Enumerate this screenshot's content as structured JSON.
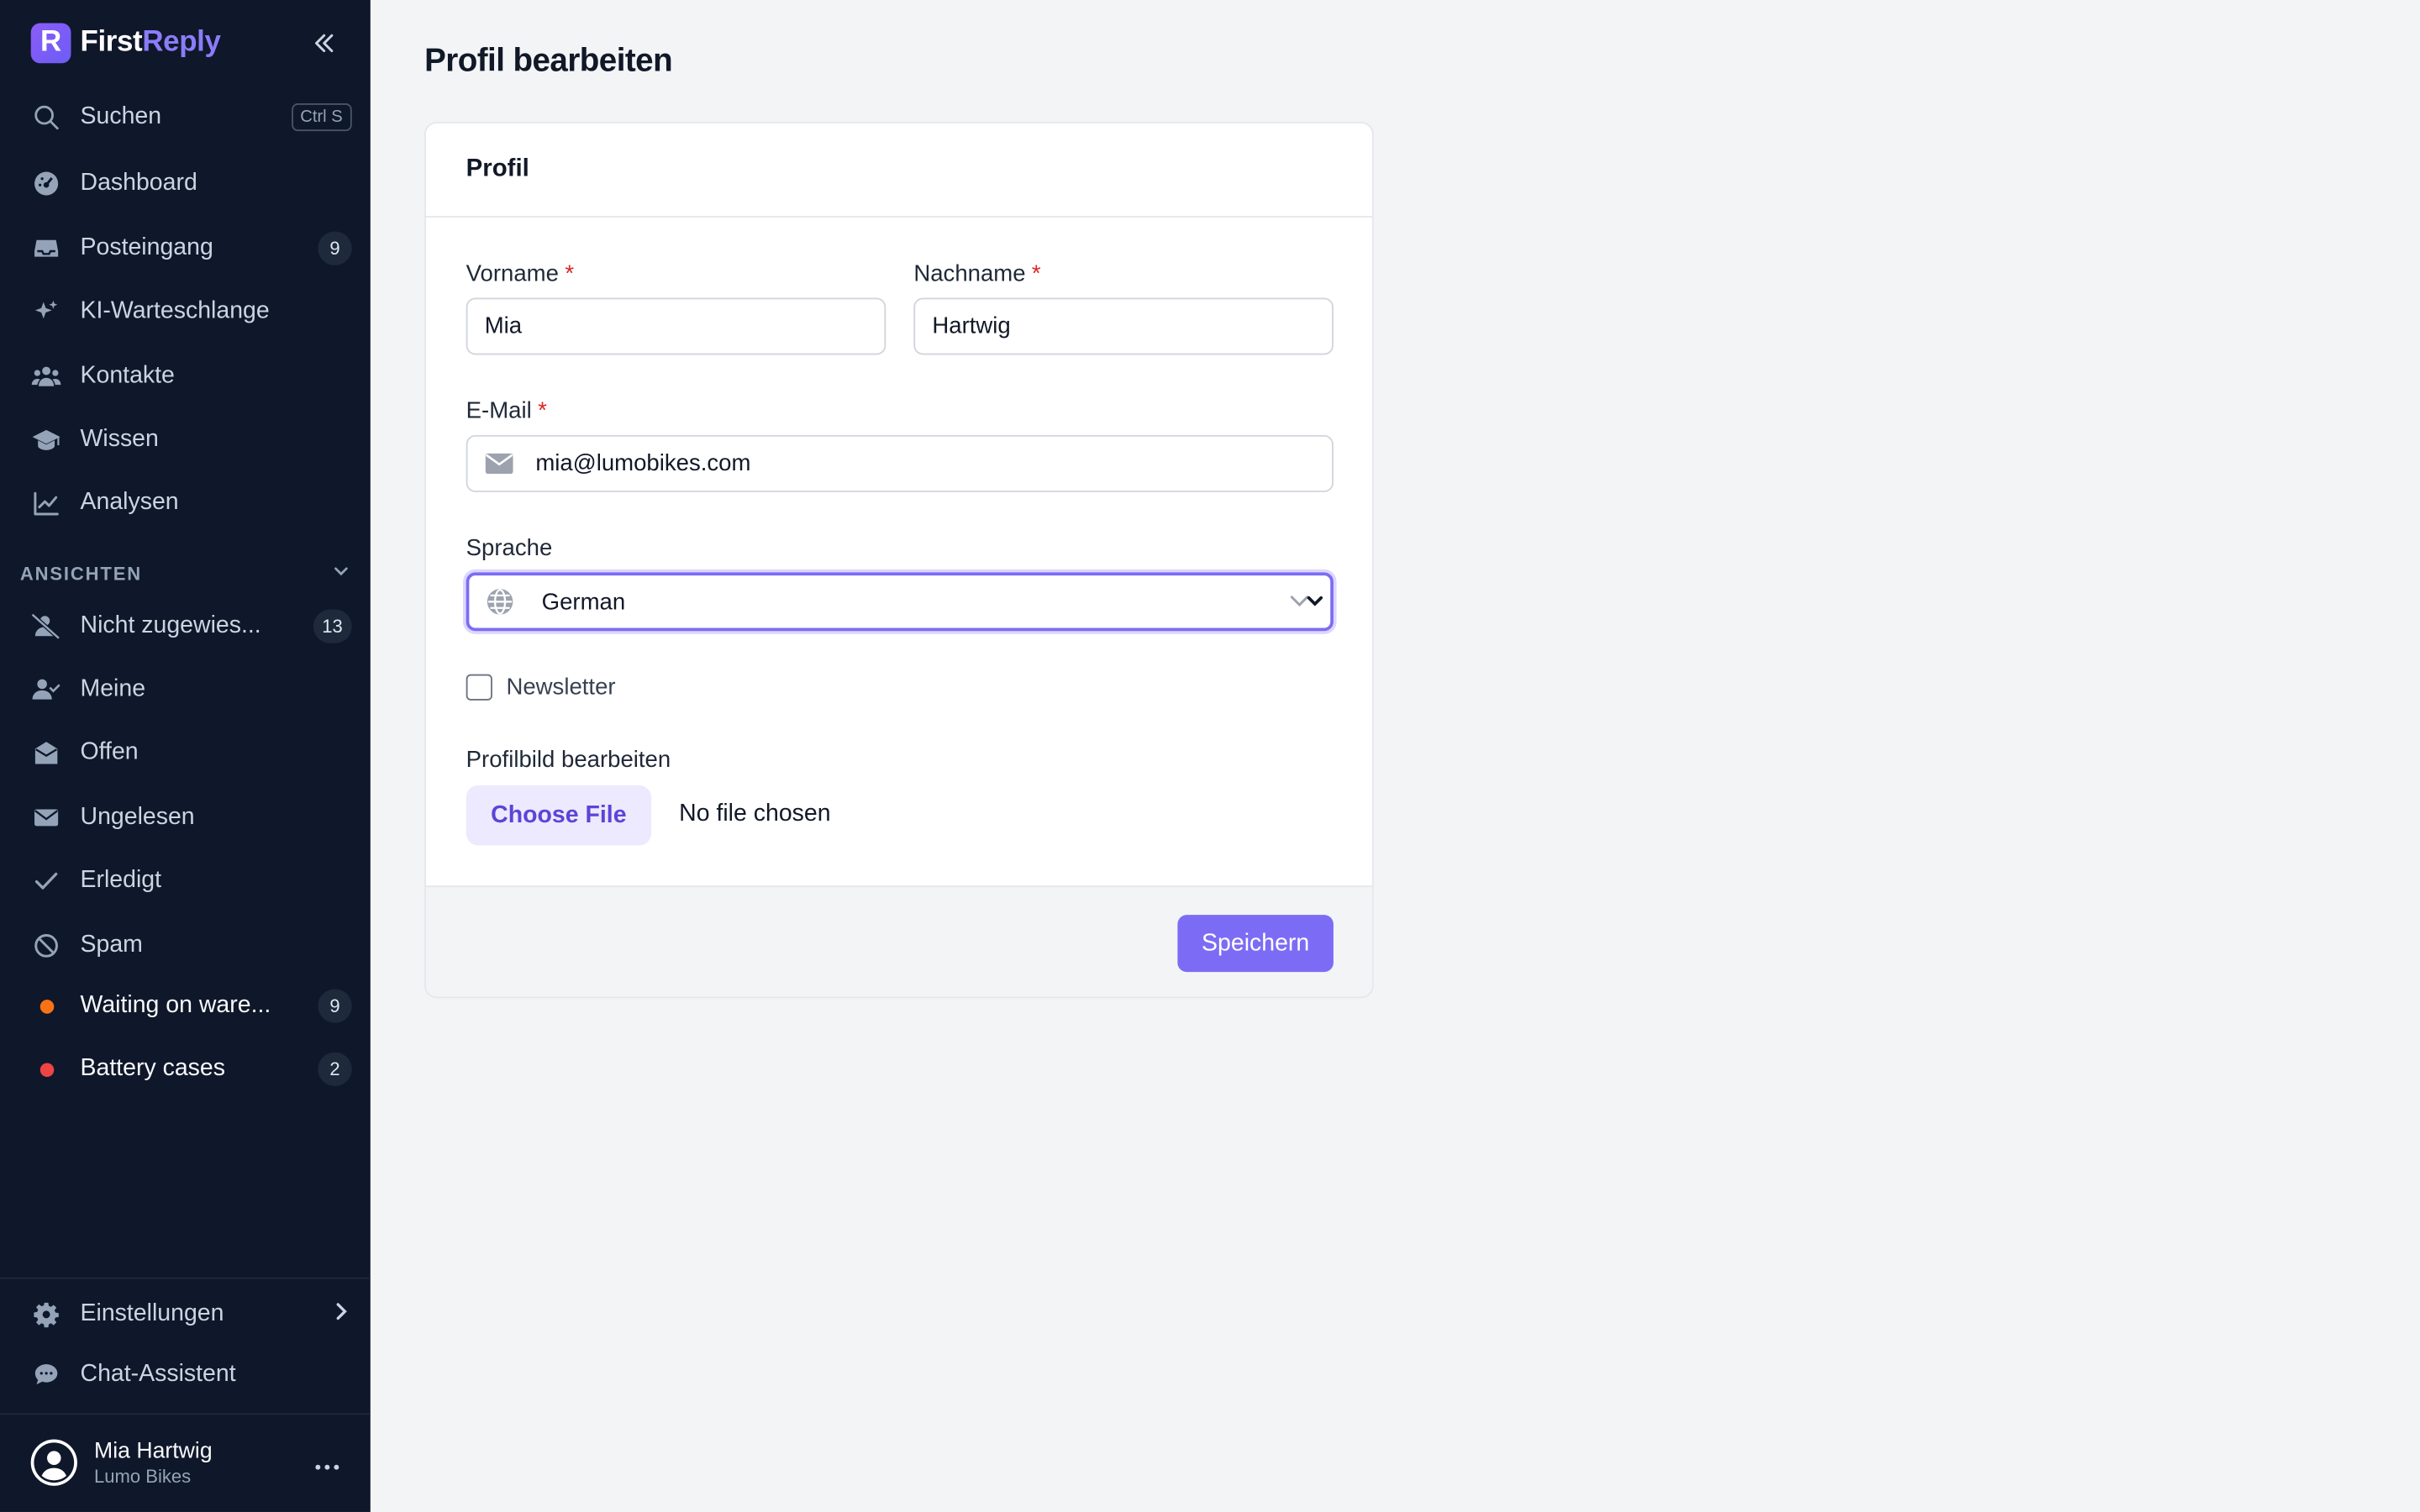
{
  "app": {
    "brand_first": "First",
    "brand_second": "Reply",
    "brand_logo_letter": "R"
  },
  "sidebar": {
    "search_label": "Suchen",
    "search_shortcut": "Ctrl S",
    "items": [
      {
        "label": "Dashboard",
        "icon": "dashboard-icon"
      },
      {
        "label": "Posteingang",
        "icon": "inbox-icon",
        "badge": "9"
      },
      {
        "label": "KI-Warteschlange",
        "icon": "sparkles-icon"
      },
      {
        "label": "Kontakte",
        "icon": "users-icon"
      },
      {
        "label": "Wissen",
        "icon": "graduation-cap-icon"
      },
      {
        "label": "Analysen",
        "icon": "chart-line-icon"
      }
    ],
    "views_title": "ANSICHTEN",
    "views": [
      {
        "label": "Nicht zugewies...",
        "icon": "user-slash-icon",
        "badge": "13"
      },
      {
        "label": "Meine",
        "icon": "user-check-icon"
      },
      {
        "label": "Offen",
        "icon": "envelope-open-icon"
      },
      {
        "label": "Ungelesen",
        "icon": "envelope-icon"
      },
      {
        "label": "Erledigt",
        "icon": "check-icon"
      },
      {
        "label": "Spam",
        "icon": "ban-icon"
      },
      {
        "label": "Waiting on ware...",
        "dot_color": "#f97316",
        "badge": "9"
      },
      {
        "label": "Battery cases",
        "dot_color": "#ef4444",
        "badge": "2"
      }
    ],
    "settings_label": "Einstellungen",
    "chat_label": "Chat-Assistent",
    "user": {
      "name": "Mia Hartwig",
      "org": "Lumo Bikes"
    }
  },
  "main": {
    "page_title": "Profil bearbeiten",
    "card_title": "Profil",
    "firstname_label": "Vorname",
    "firstname_value": "Mia",
    "lastname_label": "Nachname",
    "lastname_value": "Hartwig",
    "email_label": "E-Mail",
    "email_value": "mia@lumobikes.com",
    "language_label": "Sprache",
    "language_value": "German",
    "newsletter_label": "Newsletter",
    "avatar_label": "Profilbild bearbeiten",
    "file_button": "Choose File",
    "file_status": "No file chosen",
    "save_button": "Speichern",
    "required_mark": "*"
  },
  "colors": {
    "sidebar_bg": "#0f172a",
    "accent": "#7c6cf5",
    "required": "#dc2626"
  }
}
